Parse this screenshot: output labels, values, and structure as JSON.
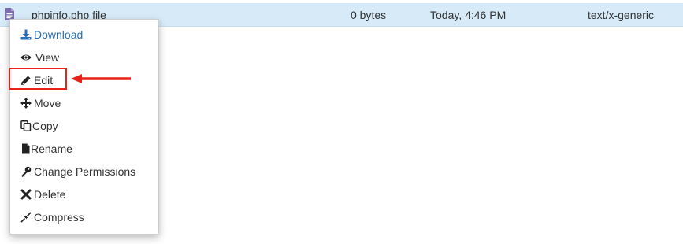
{
  "file_row": {
    "name": "phpinfo.php file",
    "size": "0 bytes",
    "modified": "Today, 4:46 PM",
    "type": "text/x-generic",
    "icon": "file-text-icon",
    "row_color": "#d6eaf8"
  },
  "context_menu": {
    "items": [
      {
        "label": "Download",
        "icon": "download-icon"
      },
      {
        "label": "View",
        "icon": "eye-icon"
      },
      {
        "label": "Edit",
        "icon": "pencil-icon"
      },
      {
        "label": "Move",
        "icon": "move-arrows-icon"
      },
      {
        "label": "Copy",
        "icon": "copy-icon"
      },
      {
        "label": "Rename",
        "icon": "file-icon"
      },
      {
        "label": "Change Permissions",
        "icon": "key-icon"
      },
      {
        "label": "Delete",
        "icon": "x-icon"
      },
      {
        "label": "Compress",
        "icon": "compress-icon"
      }
    ],
    "highlighted_item": "Edit",
    "active_item": "Download",
    "annotation_color": "#e8221b",
    "accent_color": "#2a6ebb"
  }
}
